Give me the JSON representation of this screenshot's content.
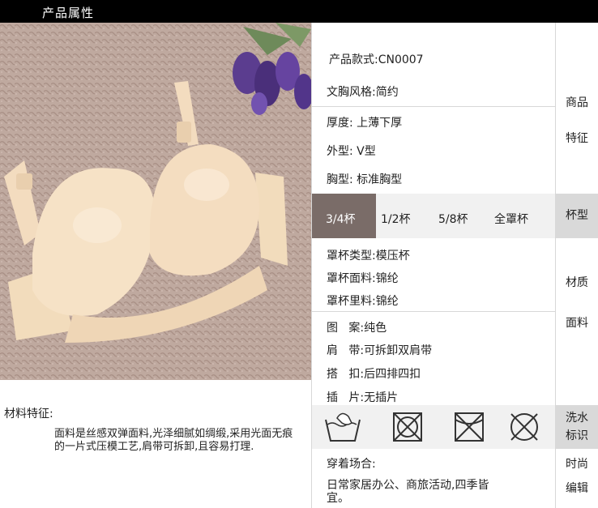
{
  "header": {
    "title": "产品属性"
  },
  "material": {
    "label": "材料特征:",
    "description": "面料是丝感双弹面料,光泽细腻如绸缎,采用光面无痕的一片式压模工艺,肩带可拆卸,且容易打理."
  },
  "specs": {
    "model": "产品款式:CN0007",
    "style": "文胸风格:简约",
    "thickness": "厚度: 上薄下厚",
    "shape": "外型: V型",
    "chest": "胸型: 标准胸型",
    "cups": [
      "3/4杯",
      "1/2杯",
      "5/8杯",
      "全罩杯"
    ],
    "cup_type": "罩杯类型:模压杯",
    "cup_fabric": "罩杯面料:锦纶",
    "cup_lining": "罩杯里料:锦纶",
    "pattern": "图   案:纯色",
    "strap": "肩   带:可拆卸双肩带",
    "clasp": "搭   扣:后四排四扣",
    "insert": "插   片:无插片",
    "occasion_label": "穿着场合:",
    "occasion_value": "日常家居办公、商旅活动,四季皆宜。"
  },
  "side": {
    "features": [
      "商品",
      "特征"
    ],
    "cup": "杯型",
    "material": [
      "材质",
      "面料"
    ],
    "wash": [
      "洗水",
      "标识"
    ],
    "fashion": [
      "时尚",
      "编辑"
    ]
  },
  "colors": {
    "header_bg": "#000000",
    "active_cup_bg": "#7a6c68",
    "row_gray": "#f1f1f1",
    "side_gray": "#d9d9d9",
    "product_tone": "#f5dfc3"
  },
  "icons": [
    "hand-wash-icon",
    "do-not-tumble-dry-icon",
    "do-not-bleach-icon",
    "do-not-dry-clean-icon"
  ]
}
